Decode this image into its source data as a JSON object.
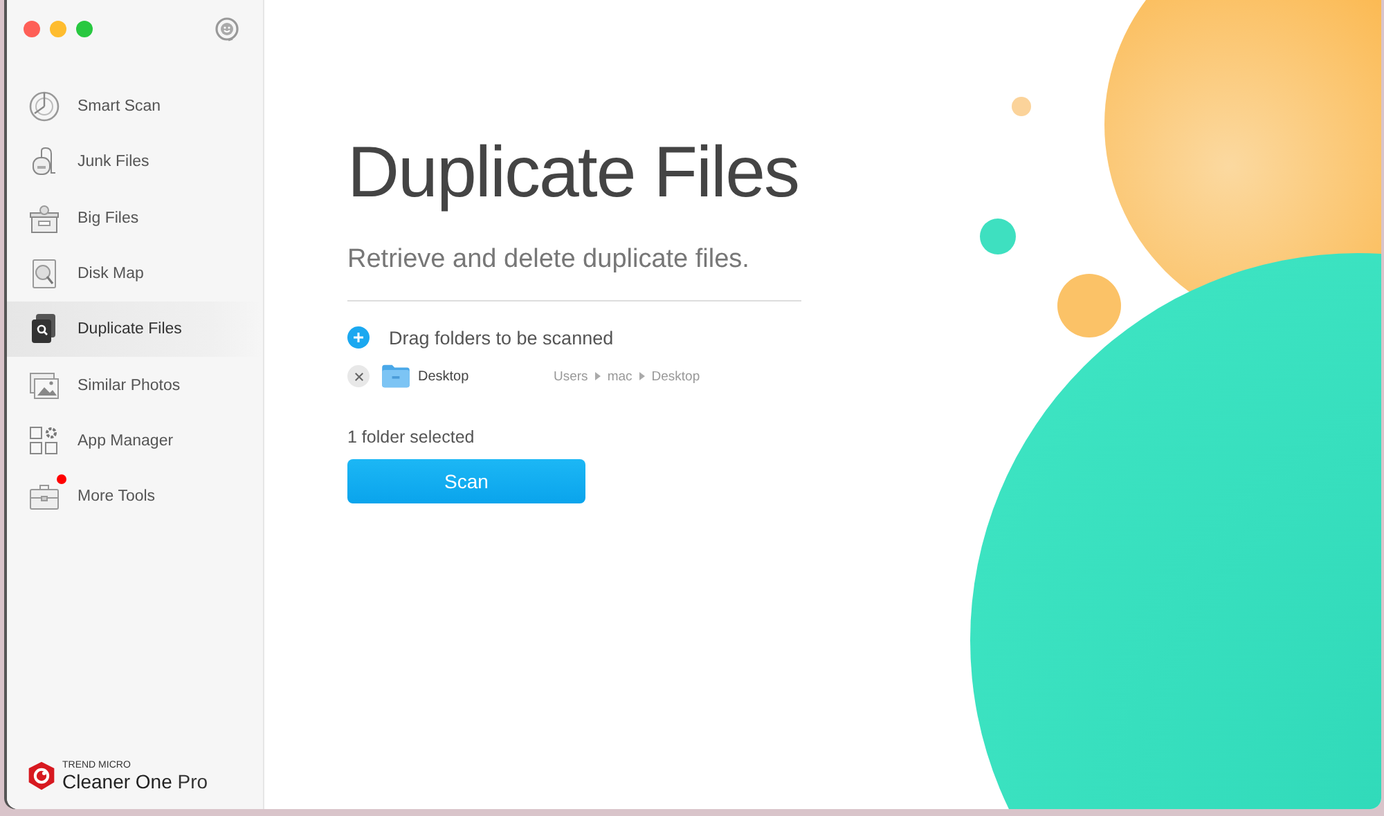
{
  "sidebar": {
    "items": [
      {
        "label": "Smart Scan",
        "kind": "radar",
        "selected": false,
        "badge": false
      },
      {
        "label": "Junk Files",
        "kind": "vacuum",
        "selected": false,
        "badge": false
      },
      {
        "label": "Big Files",
        "kind": "box",
        "selected": false,
        "badge": false
      },
      {
        "label": "Disk Map",
        "kind": "disk",
        "selected": false,
        "badge": false
      },
      {
        "label": "Duplicate Files",
        "kind": "duplicate",
        "selected": true,
        "badge": false
      },
      {
        "label": "Similar Photos",
        "kind": "photos",
        "selected": false,
        "badge": false
      },
      {
        "label": "App Manager",
        "kind": "apps",
        "selected": false,
        "badge": false
      },
      {
        "label": "More Tools",
        "kind": "toolbox",
        "selected": false,
        "badge": true
      }
    ],
    "brand": {
      "company": "TREND MICRO",
      "product": "**Cleaner One** Pro"
    }
  },
  "main": {
    "title": "Duplicate Files",
    "subtitle": "Retrieve and delete duplicate files.",
    "drop_hint": "Drag folders to be scanned",
    "folders": [
      {
        "name": "Desktop",
        "path": [
          "Users",
          "mac",
          "Desktop"
        ]
      }
    ],
    "count": "1 folder selected",
    "button": "Scan"
  }
}
